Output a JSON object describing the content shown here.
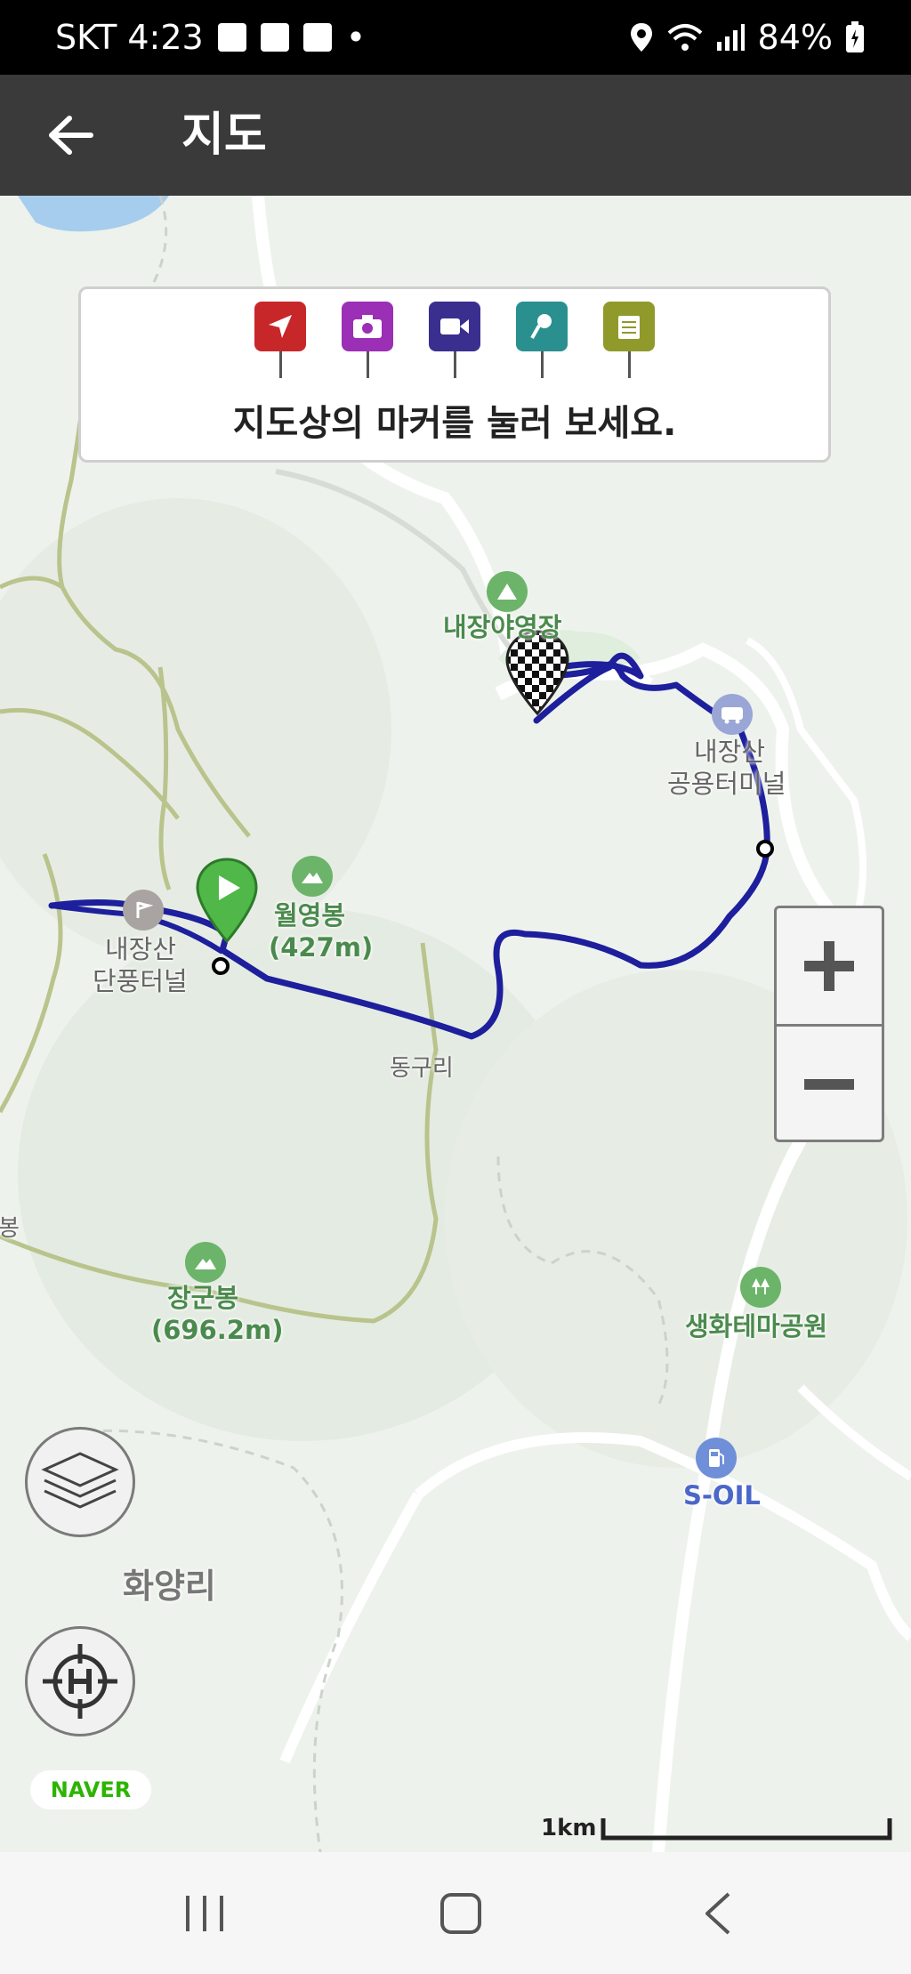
{
  "status_bar": {
    "carrier_time": "SKT 4:23",
    "dot": "•",
    "battery": "84%"
  },
  "app_bar": {
    "title": "지도"
  },
  "info_panel": {
    "instruction": "지도상의 마커를 눌러 보세요.",
    "markers": [
      {
        "name": "location",
        "color": "#c8272a"
      },
      {
        "name": "photo",
        "color": "#9b2fb5"
      },
      {
        "name": "video",
        "color": "#3a2f8f"
      },
      {
        "name": "voice",
        "color": "#2a8f8f"
      },
      {
        "name": "memo",
        "color": "#8f9a2a"
      }
    ]
  },
  "map": {
    "labels": {
      "campground": "내장야영장",
      "bus_terminal_1": "내장산",
      "bus_terminal_2": "공용터미널",
      "peak1_name": "월영봉",
      "peak1_height": "(427m)",
      "tunnel_1": "내장산",
      "tunnel_2": "단풍터널",
      "village1": "동구리",
      "peak2_name": "장군봉",
      "peak2_height": "(696.2m)",
      "park": "생화테마공원",
      "gas_station": "S-OIL",
      "village2": "화양리",
      "edge_peak": "봉"
    },
    "scale": "1km",
    "logo": "NAVER",
    "route_color": "#1d1f9c"
  },
  "icons": [
    "back-arrow-icon",
    "layers-icon",
    "home-location-icon",
    "zoom-in-icon",
    "zoom-out-icon"
  ]
}
